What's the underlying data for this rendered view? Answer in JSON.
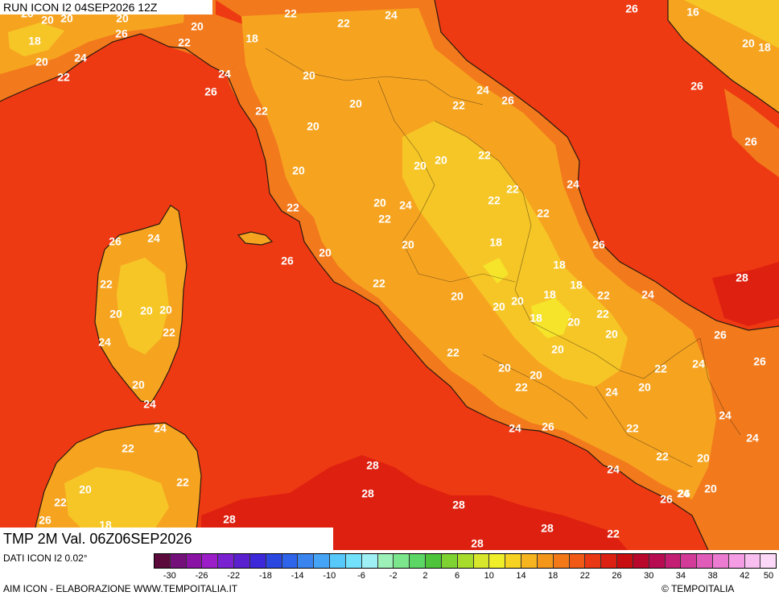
{
  "header": {
    "run_title": "RUN ICON I2 04SEP2026 12Z"
  },
  "footer": {
    "valid_title": "TMP 2M Val. 06Z06SEP2026",
    "data_source": "DATI ICON I2 0.02°",
    "credit_left": "AIM ICON - ELABORAZIONE WWW.TEMPOITALIA.IT",
    "credit_right": "© TEMPOITALIA"
  },
  "legend": {
    "colors": [
      "#5c0a3c",
      "#74107a",
      "#8a12a4",
      "#9c1ec8",
      "#7a22d2",
      "#5a20d0",
      "#3c28d8",
      "#2a48e0",
      "#2e64ea",
      "#3a84f0",
      "#46a4f6",
      "#56c8fa",
      "#72e2fc",
      "#9ef0f4",
      "#9cf0b8",
      "#7ce68c",
      "#5cd664",
      "#4ec43a",
      "#7ed232",
      "#a8dc2c",
      "#d8e62c",
      "#f0ee28",
      "#f6d222",
      "#f6b41e",
      "#f4961a",
      "#f27818",
      "#f05a16",
      "#e83814",
      "#dc2012",
      "#c80e10",
      "#b8082c",
      "#b80c52",
      "#c41e74",
      "#d23c98",
      "#e05cb8",
      "#ec7cd2",
      "#f49ce4",
      "#f8bef0",
      "#fcd8f8"
    ],
    "tick_labels": [
      "-30",
      "-26",
      "-22",
      "-18",
      "-14",
      "-10",
      "-6",
      "-2",
      "2",
      "6",
      "10",
      "14",
      "18",
      "22",
      "26",
      "30",
      "34",
      "38",
      "42",
      "50"
    ]
  },
  "map": {
    "colors": {
      "sea": "#ee3a12",
      "sea_warm": "#de2010",
      "land_warm": "#f27a1c",
      "land_mild": "#f6a420",
      "land_cool": "#f6c626",
      "land_cold": "#f5e42a",
      "border": "#2a1a10"
    },
    "temperature_labels": [
      {
        "v": "20"
      },
      {
        "v": "20"
      },
      {
        "v": "20"
      },
      {
        "v": "20"
      },
      {
        "v": "22"
      },
      {
        "v": "22"
      },
      {
        "v": "24"
      },
      {
        "v": "26"
      },
      {
        "v": "16"
      },
      {
        "v": "18"
      },
      {
        "v": "26"
      },
      {
        "v": "20"
      },
      {
        "v": "18"
      },
      {
        "v": "22"
      },
      {
        "v": "20"
      },
      {
        "v": "18"
      },
      {
        "v": "20"
      },
      {
        "v": "24"
      },
      {
        "v": "22"
      },
      {
        "v": "24"
      },
      {
        "v": "20"
      },
      {
        "v": "26"
      },
      {
        "v": "26"
      },
      {
        "v": "22"
      },
      {
        "v": "20"
      },
      {
        "v": "22"
      },
      {
        "v": "24"
      },
      {
        "v": "26"
      },
      {
        "v": "20"
      },
      {
        "v": "22"
      },
      {
        "v": "26"
      },
      {
        "v": "20"
      },
      {
        "v": "20"
      },
      {
        "v": "24"
      },
      {
        "v": "20"
      },
      {
        "v": "22"
      },
      {
        "v": "22"
      },
      {
        "v": "20"
      },
      {
        "v": "22"
      },
      {
        "v": "22"
      },
      {
        "v": "26"
      },
      {
        "v": "24"
      },
      {
        "v": "20"
      },
      {
        "v": "24"
      },
      {
        "v": "26"
      },
      {
        "v": "20"
      },
      {
        "v": "18"
      },
      {
        "v": "26"
      },
      {
        "v": "22"
      },
      {
        "v": "22"
      },
      {
        "v": "24"
      },
      {
        "v": "20"
      },
      {
        "v": "18"
      },
      {
        "v": "28"
      },
      {
        "v": "20"
      },
      {
        "v": "20"
      },
      {
        "v": "20"
      },
      {
        "v": "20"
      },
      {
        "v": "18"
      },
      {
        "v": "22"
      },
      {
        "v": "24"
      },
      {
        "v": "22"
      },
      {
        "v": "22"
      },
      {
        "v": "18"
      },
      {
        "v": "20"
      },
      {
        "v": "20"
      },
      {
        "v": "26"
      },
      {
        "v": "24"
      },
      {
        "v": "22"
      },
      {
        "v": "20"
      },
      {
        "v": "18"
      },
      {
        "v": "24"
      },
      {
        "v": "26"
      },
      {
        "v": "20"
      },
      {
        "v": "20"
      },
      {
        "v": "22"
      },
      {
        "v": "22"
      },
      {
        "v": "20"
      },
      {
        "v": "20"
      },
      {
        "v": "24"
      },
      {
        "v": "22"
      },
      {
        "v": "26"
      },
      {
        "v": "24"
      },
      {
        "v": "24"
      },
      {
        "v": "26"
      },
      {
        "v": "24"
      },
      {
        "v": "22"
      },
      {
        "v": "24"
      },
      {
        "v": "22"
      },
      {
        "v": "28"
      },
      {
        "v": "22"
      },
      {
        "v": "20"
      },
      {
        "v": "20"
      },
      {
        "v": "24"
      },
      {
        "v": "28"
      },
      {
        "v": "20"
      },
      {
        "v": "22"
      },
      {
        "v": "26"
      },
      {
        "v": "24"
      },
      {
        "v": "28"
      },
      {
        "v": "22"
      },
      {
        "v": "20"
      },
      {
        "v": "26"
      },
      {
        "v": "18"
      },
      {
        "v": "28"
      },
      {
        "v": "28"
      },
      {
        "v": "28"
      },
      {
        "v": "22"
      }
    ]
  }
}
